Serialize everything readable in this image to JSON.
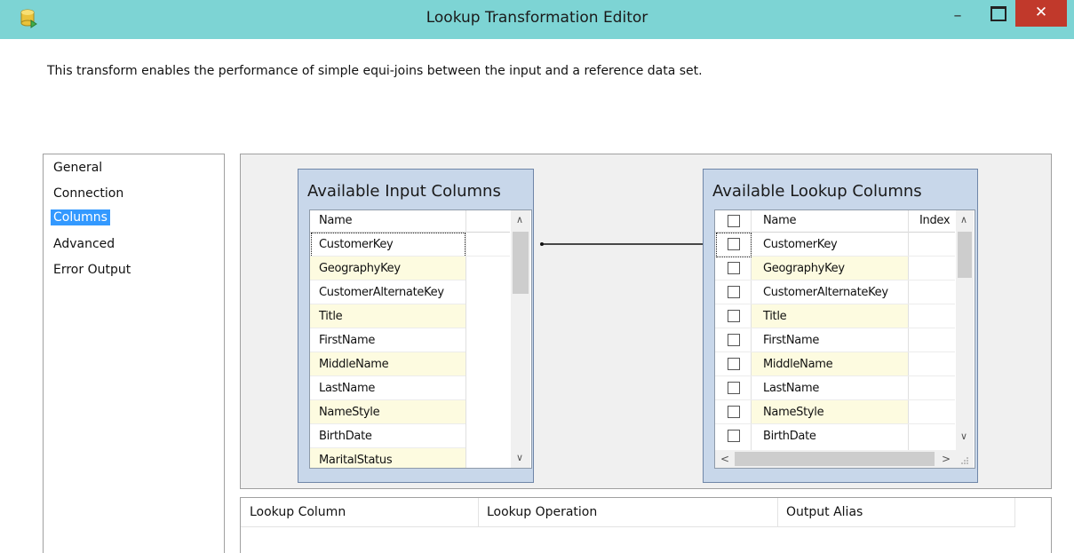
{
  "window": {
    "title": "Lookup Transformation Editor",
    "minimize_glyph": "–",
    "close_glyph": "✕"
  },
  "description": "This transform enables the performance of simple equi-joins between the input and a reference data set.",
  "nav": {
    "items": [
      "General",
      "Connection",
      "Columns",
      "Advanced",
      "Error Output"
    ],
    "selected": "Columns"
  },
  "input_columns": {
    "title": "Available Input Columns",
    "header_name": "Name",
    "rows": [
      "CustomerKey",
      "GeographyKey",
      "CustomerAlternateKey",
      "Title",
      "FirstName",
      "MiddleName",
      "LastName",
      "NameStyle",
      "BirthDate",
      "MaritalStatus"
    ]
  },
  "lookup_columns": {
    "title": "Available Lookup Columns",
    "header_name": "Name",
    "header_index": "Index",
    "rows": [
      "CustomerKey",
      "GeographyKey",
      "CustomerAlternateKey",
      "Title",
      "FirstName",
      "MiddleName",
      "LastName",
      "NameStyle",
      "BirthDate"
    ]
  },
  "mapping": {
    "from": "CustomerKey",
    "to": "CustomerKey"
  },
  "bottom_grid": {
    "headers": [
      "Lookup Column",
      "Lookup Operation",
      "Output Alias"
    ]
  },
  "icons": {
    "app": "database-icon",
    "scroll_up": "∧",
    "scroll_down": "∨",
    "scroll_left": "<",
    "scroll_right": ">"
  },
  "colors": {
    "titlebar": "#7dd4d4",
    "close_button": "#c1392b",
    "selected_nav": "#3399ff",
    "box_background": "#c8d7ea",
    "alt_row": "#fdfbe0"
  }
}
